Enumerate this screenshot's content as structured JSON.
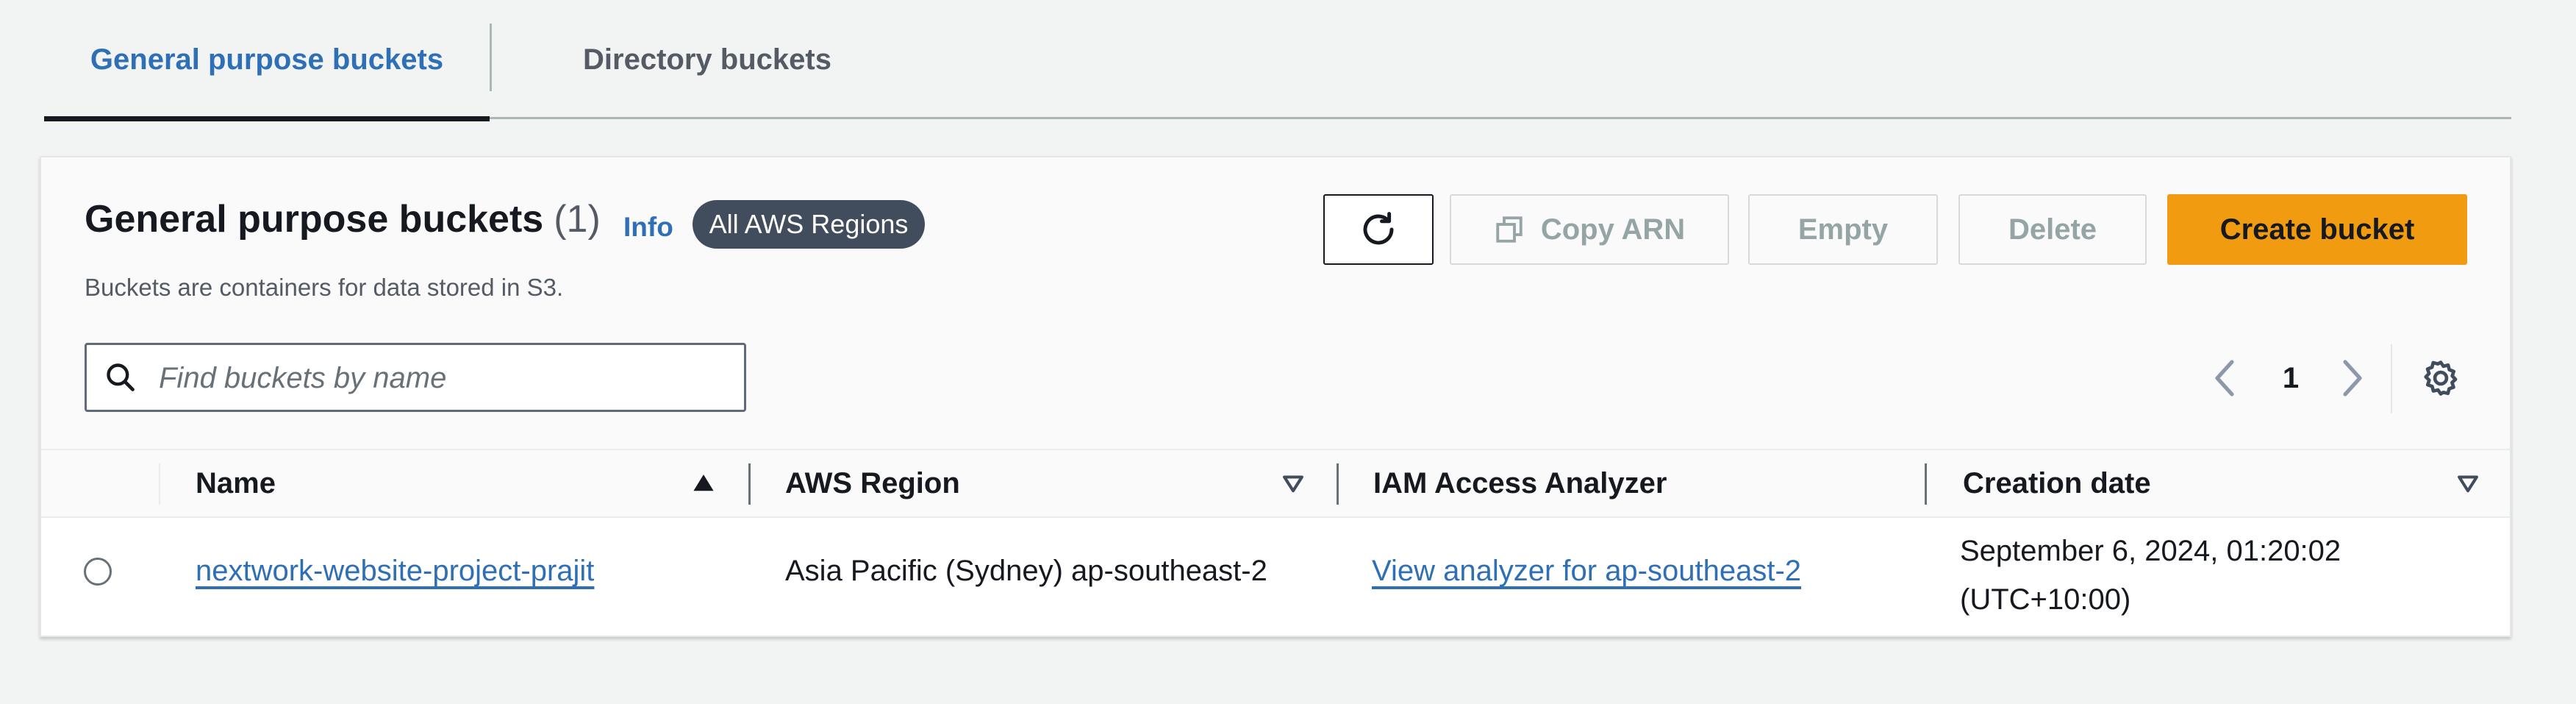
{
  "tabs": [
    {
      "label": "General purpose buckets",
      "active": true
    },
    {
      "label": "Directory buckets",
      "active": false
    }
  ],
  "panel": {
    "title": "General purpose buckets",
    "count": "(1)",
    "info_label": "Info",
    "region_badge": "All AWS Regions",
    "description": "Buckets are containers for data stored in S3."
  },
  "toolbar": {
    "refresh_icon": "refresh-icon",
    "copy_arn_label": "Copy ARN",
    "empty_label": "Empty",
    "delete_label": "Delete",
    "create_label": "Create bucket"
  },
  "search": {
    "placeholder": "Find buckets by name",
    "value": ""
  },
  "pagination": {
    "current_page": "1"
  },
  "table": {
    "columns": [
      "Name",
      "AWS Region",
      "IAM Access Analyzer",
      "Creation date"
    ],
    "rows": [
      {
        "name": "nextwork-website-project-prajit",
        "region": "Asia Pacific (Sydney) ap-southeast-2",
        "analyzer": "View analyzer for ap-southeast-2",
        "creation_date": "September 6, 2024, 01:20:02 (UTC+10:00)"
      }
    ]
  },
  "colors": {
    "accent": "#2e6fb5",
    "primary_button": "#f19b11",
    "badge": "#414d5c",
    "background": "#f2f3f3"
  }
}
